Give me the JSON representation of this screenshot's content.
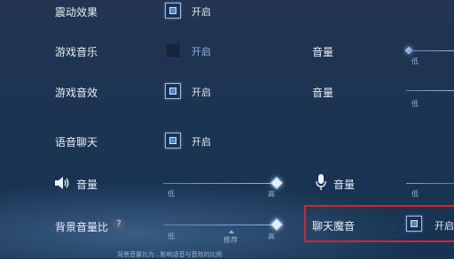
{
  "settings": {
    "vibration": {
      "label": "震动效果",
      "checked": true,
      "state_text": "开启"
    },
    "game_music": {
      "label": "游戏音乐",
      "checked": false,
      "state_text": "开启",
      "volume_label": "音量",
      "volume_min": "低"
    },
    "game_sfx": {
      "label": "游戏音效",
      "checked": true,
      "state_text": "开启",
      "volume_label": "音量",
      "volume_min": "低"
    },
    "voice_chat": {
      "label": "语音聊天",
      "checked": true,
      "state_text": "开启"
    },
    "speaker_volume": {
      "label": "音量",
      "min": "低",
      "max": "高",
      "icon": "speaker-icon"
    },
    "mic_volume": {
      "label": "音量",
      "min": "低",
      "icon": "microphone-icon"
    },
    "bg_volume_ratio": {
      "label": "背景音量比",
      "min": "低",
      "max": "高",
      "recommend": "推荐",
      "help_icon": "question-icon"
    },
    "voice_changer": {
      "label": "聊天魔音",
      "checked": true,
      "state_text": "开启"
    },
    "footer_hint": "背景音量比为...影响话音与音效的比例"
  },
  "accent_color": "#4f86c7",
  "highlight_color": "#d6252a"
}
